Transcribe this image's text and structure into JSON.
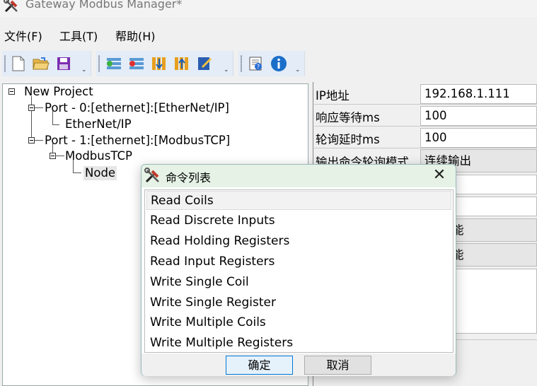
{
  "window": {
    "title": "Gateway Modbus Manager*",
    "icon": "tools-icon"
  },
  "menu": [
    {
      "label": "文件(F)"
    },
    {
      "label": "工具(T)"
    },
    {
      "label": "帮助(H)"
    }
  ],
  "toolbar": {
    "groups": [
      {
        "buttons": [
          "new-file-icon",
          "open-folder-icon",
          "save-icon"
        ]
      },
      {
        "buttons": [
          "add-port-icon",
          "delete-icon",
          "download-icon",
          "upload-icon",
          "edit-icon"
        ]
      },
      {
        "buttons": [
          "find-icon",
          "info-icon"
        ]
      }
    ],
    "dropdown_glyph": "⌄"
  },
  "tree": {
    "root": "New Project",
    "port0": "Port - 0:[ethernet]:[EtherNet/IP]",
    "port0_child": "EtherNet/IP",
    "port1": "Port - 1:[ethernet]:[ModbusTCP]",
    "port1_child": "ModbusTCP",
    "node": "Node"
  },
  "properties": {
    "rows": [
      {
        "label": "IP地址",
        "value": "192.168.1.111"
      },
      {
        "label": "响应等待ms",
        "value": "100"
      },
      {
        "label": "轮询延时ms",
        "value": "100"
      },
      {
        "label": "输出命令轮询模式",
        "value": "连续输出"
      }
    ],
    "partial_btn_1": "能",
    "partial_btn_2": "能"
  },
  "dialog": {
    "title": "命令列表",
    "close_glyph": "✕",
    "items": [
      "Read Coils",
      "Read Discrete Inputs",
      "Read Holding Registers",
      "Read Input Registers",
      "Write Single Coil",
      "Write Single Register",
      "Write Multiple Coils",
      "Write Multiple Registers"
    ],
    "selected_index": 0,
    "ok_label": "确定",
    "cancel_label": "取消"
  }
}
